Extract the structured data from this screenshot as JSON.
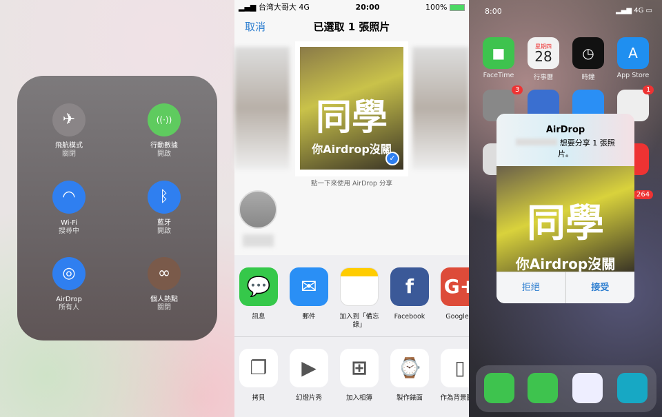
{
  "control_center": {
    "items": [
      {
        "icon": "airplane-icon",
        "label": "飛航模式",
        "state": "關閉",
        "color": "#8a8587",
        "glyph": "✈"
      },
      {
        "icon": "cellular-icon",
        "label": "行動數據",
        "state": "開啟",
        "color": "#5fcb5f",
        "glyph": "((·))"
      },
      {
        "icon": "wifi-icon",
        "label": "Wi-Fi",
        "state": "搜尋中",
        "color": "#2f7ff0",
        "glyph": "◠"
      },
      {
        "icon": "bluetooth-icon",
        "label": "藍牙",
        "state": "開啟",
        "color": "#2f7ff0",
        "glyph": "ᛒ"
      },
      {
        "icon": "airdrop-icon",
        "label": "AirDrop",
        "state": "所有人",
        "color": "#2f7ff0",
        "glyph": "◎"
      },
      {
        "icon": "hotspot-icon",
        "label": "個人熱點",
        "state": "關閉",
        "color": "#7a5a4a",
        "glyph": "∞"
      }
    ]
  },
  "share_sheet": {
    "status": {
      "carrier": "台湾大哥大",
      "network": "4G",
      "time": "20:00",
      "battery": "100%"
    },
    "cancel": "取消",
    "title": "已選取 1 張照片",
    "photo_text": {
      "big": "同學",
      "small": "你Airdrop沒關"
    },
    "hint": "點一下來使用 AirDrop 分享",
    "apps": [
      {
        "label": "訊息",
        "color": "#35c84a",
        "glyph": "💬"
      },
      {
        "label": "郵件",
        "color": "#2a8ff5",
        "glyph": "✉"
      },
      {
        "label": "加入到「備忘錄」",
        "color": "#fff",
        "glyph": ""
      },
      {
        "label": "Facebook",
        "color": "#3b5998",
        "glyph": "f"
      },
      {
        "label": "Google+",
        "color": "#dd4b39",
        "glyph": "G+"
      }
    ],
    "actions": [
      {
        "label": "拷貝",
        "glyph": "❐"
      },
      {
        "label": "幻燈片秀",
        "glyph": "▶"
      },
      {
        "label": "加入相簿",
        "glyph": "⊞"
      },
      {
        "label": "製作錶面",
        "glyph": "⌚"
      },
      {
        "label": "作為背景圖片",
        "glyph": "▯"
      }
    ]
  },
  "home": {
    "time": "8:00",
    "network": "4G",
    "apps": [
      {
        "label": "FaceTime",
        "color": "#3ec34e",
        "glyph": "■"
      },
      {
        "label": "行事曆",
        "color": "#f2f2f2",
        "glyph": "28",
        "sub": "星期四"
      },
      {
        "label": "時鐘",
        "color": "#111",
        "glyph": "◷"
      },
      {
        "label": "App Store",
        "color": "#1f8ff0",
        "glyph": "A"
      }
    ],
    "badges": [
      "3",
      "1",
      "264"
    ],
    "dialog": {
      "title": "AirDrop",
      "message": "想要分享 1 張照片。",
      "decline": "拒絕",
      "accept": "接受",
      "photo_big": "同學",
      "photo_small": "你Airdrop沒關"
    }
  }
}
